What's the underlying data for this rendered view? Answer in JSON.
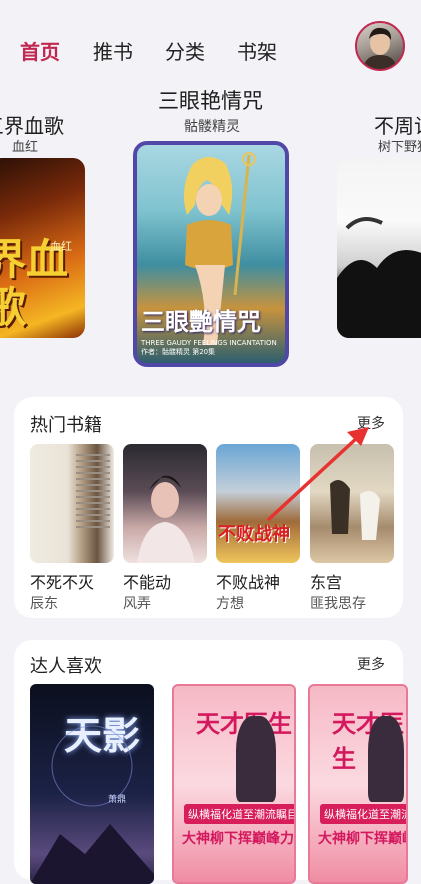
{
  "nav": {
    "tabs": [
      {
        "label": "首页",
        "active": true
      },
      {
        "label": "推书",
        "active": false
      },
      {
        "label": "分类",
        "active": false
      },
      {
        "label": "书架",
        "active": false
      }
    ]
  },
  "carousel": {
    "left": {
      "title": "三界血歌",
      "title_visible": "三界血歌",
      "author": "血红",
      "cover_text": "界血歌",
      "cover_small": "血红"
    },
    "center": {
      "title": "三眼艳情咒",
      "author": "骷髅精灵",
      "cover_title": "三眼艷情咒",
      "cover_sub": "THREE GAUDY FEELINGS INCANTATION 作者：骷髅精灵 第20集"
    },
    "right": {
      "title": "不周记",
      "title_visible": "不周记",
      "author": "树下野狐"
    }
  },
  "hot_books": {
    "title": "热门书籍",
    "more": "更多",
    "items": [
      {
        "name": "不死不灭",
        "author": "辰东"
      },
      {
        "name": "不能动",
        "author": "风弄"
      },
      {
        "name": "不败战神",
        "author": "方想",
        "cover_text": "不败战神"
      },
      {
        "name": "东宫",
        "author": "匪我思存"
      }
    ]
  },
  "fav_books": {
    "title": "达人喜欢",
    "more": "更多",
    "items": [
      {
        "cover_title": "天影",
        "cover_author": "萧鼎"
      },
      {
        "cover_title": "天才医生",
        "cover_banner": "纵横福化道至潮流瞩目推荐",
        "cover_slogan": "大神柳下挥巅峰力作"
      },
      {
        "cover_title": "天才医生",
        "cover_banner": "纵横福化道至潮流瞩目推荐",
        "cover_slogan": "大神柳下挥巅峰力作"
      }
    ]
  },
  "colors": {
    "accent": "#c2274f",
    "background": "#f2f2f7",
    "annotation_arrow": "#e8322f"
  }
}
